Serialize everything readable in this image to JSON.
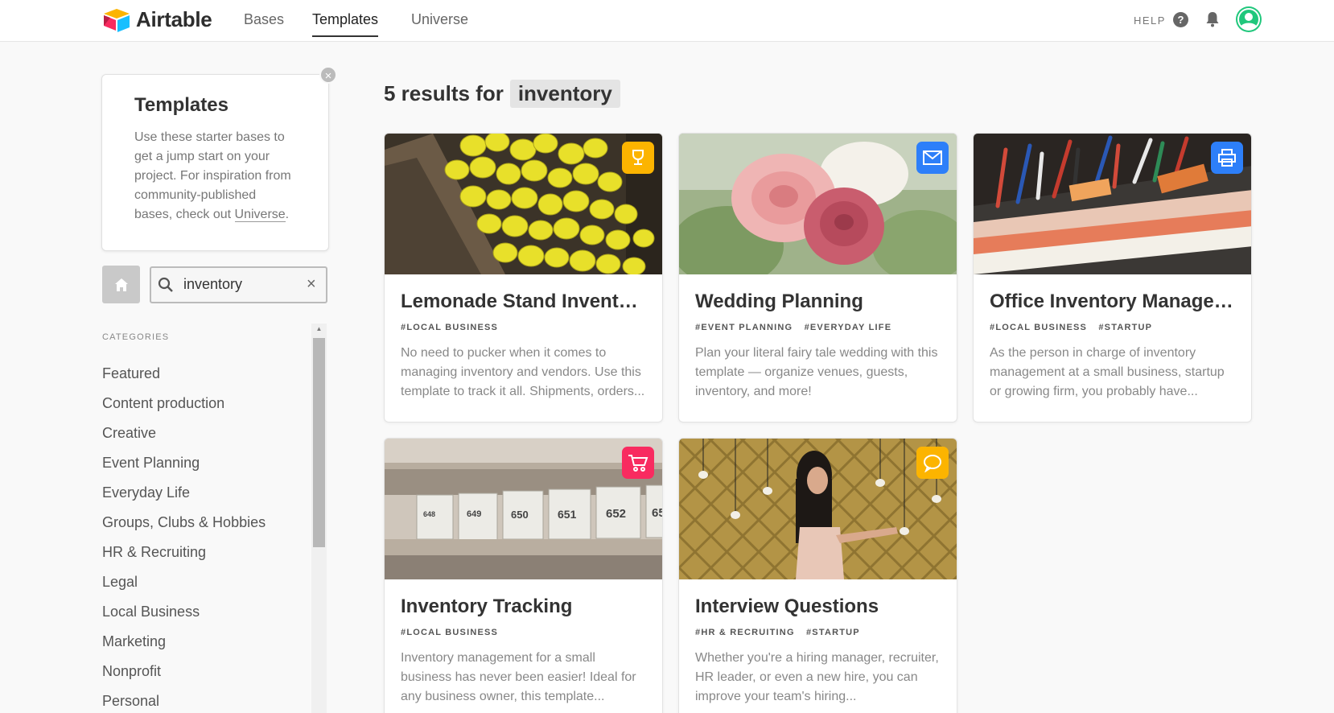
{
  "header": {
    "logo_text": "Airtable",
    "nav": [
      {
        "label": "Bases",
        "active": false
      },
      {
        "label": "Templates",
        "active": true
      },
      {
        "label": "Universe",
        "active": false
      }
    ],
    "help_label": "HELP",
    "help_icon_glyph": "?"
  },
  "sidebar": {
    "info_title": "Templates",
    "info_text": "Use these starter bases to get a jump start on your project. For inspiration from community-published bases, check out",
    "info_link": "Universe",
    "info_end": ".",
    "close_glyph": "×",
    "search": {
      "value": "inventory",
      "clear_glyph": "×"
    },
    "categories_label": "CATEGORIES",
    "categories": [
      "Featured",
      "Content production",
      "Creative",
      "Event Planning",
      "Everyday Life",
      "Groups, Clubs & Hobbies",
      "HR & Recruiting",
      "Legal",
      "Local Business",
      "Marketing",
      "Nonprofit",
      "Personal"
    ],
    "scroll_up_glyph": "▲"
  },
  "results": {
    "prefix": "5 results for",
    "query": "inventory",
    "cards": [
      {
        "title": "Lemonade Stand Inventory",
        "tags": [
          "#LOCAL BUSINESS"
        ],
        "desc": "No need to pucker when it comes to managing inventory and vendors. Use this template to track it all. Shipments, orders...",
        "icon": "trophy-icon",
        "icon_color": "#fcb400"
      },
      {
        "title": "Wedding Planning",
        "tags": [
          "#EVENT PLANNING",
          "#EVERYDAY LIFE"
        ],
        "desc": "Plan your literal fairy tale wedding with this template — organize venues, guests, inventory, and more!",
        "icon": "mail-icon",
        "icon_color": "#2d7ff9"
      },
      {
        "title": "Office Inventory Managem...",
        "tags": [
          "#LOCAL BUSINESS",
          "#STARTUP"
        ],
        "desc": "As the person in charge of inventory management at a small business, startup or growing firm, you probably have...",
        "icon": "printer-icon",
        "icon_color": "#2d7ff9"
      },
      {
        "title": "Inventory Tracking",
        "tags": [
          "#LOCAL BUSINESS"
        ],
        "desc": "Inventory management for a small business has never been easier! Ideal for any business owner, this template...",
        "icon": "cart-icon",
        "icon_color": "#f82b60"
      },
      {
        "title": "Interview Questions",
        "tags": [
          "#HR & RECRUITING",
          "#STARTUP"
        ],
        "desc": "Whether you're a hiring manager, recruiter, HR leader, or even a new hire, you can improve your team's hiring...",
        "icon": "chat-icon",
        "icon_color": "#fcb400"
      }
    ],
    "shelf_labels": [
      "648",
      "649",
      "650",
      "651",
      "652",
      "65"
    ]
  }
}
